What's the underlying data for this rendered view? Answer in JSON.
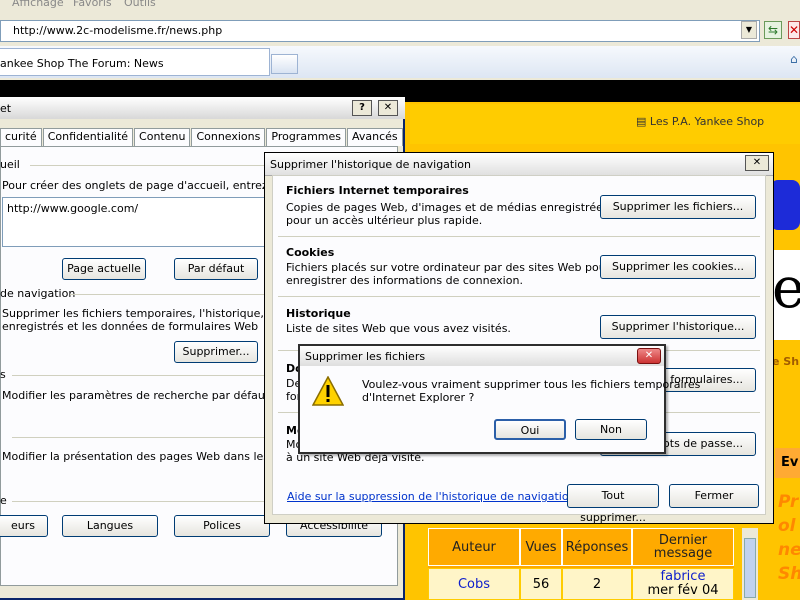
{
  "browser": {
    "menu": [
      "Affichage",
      "Favoris",
      "Outils"
    ],
    "url": "http://www.2c-modelisme.fr/news.php",
    "tab_title": "ankee Shop The Forum: News"
  },
  "webpage": {
    "header_link": "Les P.A. Yankee Shop",
    "big_letter": "e",
    "side_text": "e Sh",
    "ev_text": "Ev",
    "side_italic": "Pr\nol\nne\nSh",
    "table_headers": [
      "Auteur",
      "Vues",
      "Réponses",
      "Dernier message"
    ],
    "row": {
      "auteur": "Cobs",
      "vues": "56",
      "reponses": "2",
      "dernier_user": "fabrice",
      "dernier_date": "mer fév 04"
    }
  },
  "options_dialog": {
    "title_fragment": "et",
    "tabs": [
      "curité",
      "Confidentialité",
      "Contenu",
      "Connexions",
      "Programmes",
      "Avancés"
    ],
    "home": {
      "group": "ueil",
      "desc": "Pour créer des onglets de page d'accueil, entrez une ad",
      "value": "http://www.google.com/",
      "btn_current": "Page actuelle",
      "btn_default": "Par défaut"
    },
    "history": {
      "group": "de navigation",
      "desc1": "Supprimer les fichiers temporaires, l'historique, les cook",
      "desc2": "enregistrés et les données de formulaires Web",
      "btn_delete": "Supprimer..."
    },
    "search": {
      "group": "s",
      "desc": "Modifier les paramètres de recherche par défaut."
    },
    "tabs_group": {
      "desc": "Modifier la présentation des pages Web dans les onglet"
    },
    "appearance": {
      "group": "e",
      "buttons": [
        "eurs",
        "Langues",
        "Polices",
        "Accessibilité"
      ]
    }
  },
  "delete_dialog": {
    "title": "Supprimer l'historique de navigation",
    "sections": [
      {
        "heading": "Fichiers Internet temporaires",
        "desc1": "Copies de pages Web, d'images et de médias enregistrées",
        "desc2": "pour un accès ultérieur plus rapide.",
        "button": "Supprimer les fichiers..."
      },
      {
        "heading": "Cookies",
        "desc1": "Fichiers placés sur votre ordinateur par des sites Web pour",
        "desc2": "enregistrer des informations de connexion.",
        "button": "Supprimer les cookies..."
      },
      {
        "heading": "Historique",
        "desc1": "Liste de sites Web que vous avez visités.",
        "desc2": "",
        "button": "Supprimer l'historique..."
      },
      {
        "heading": "Do",
        "desc1": "De",
        "desc2": "for",
        "button": "es formulaires..."
      },
      {
        "heading": "Mo",
        "desc1": "Mo",
        "desc2": "à un site Web déjà visité.",
        "button": "mots de passe..."
      }
    ],
    "help_link": "Aide sur la suppression de l'historique de navigation",
    "btn_delete_all": "Tout supprimer...",
    "btn_close": "Fermer"
  },
  "confirm_dialog": {
    "title": "Supprimer les fichiers",
    "message1": "Voulez-vous vraiment supprimer tous les fichiers temporaires",
    "message2": "d'Internet Explorer ?",
    "btn_yes": "Oui",
    "btn_no": "Non"
  }
}
